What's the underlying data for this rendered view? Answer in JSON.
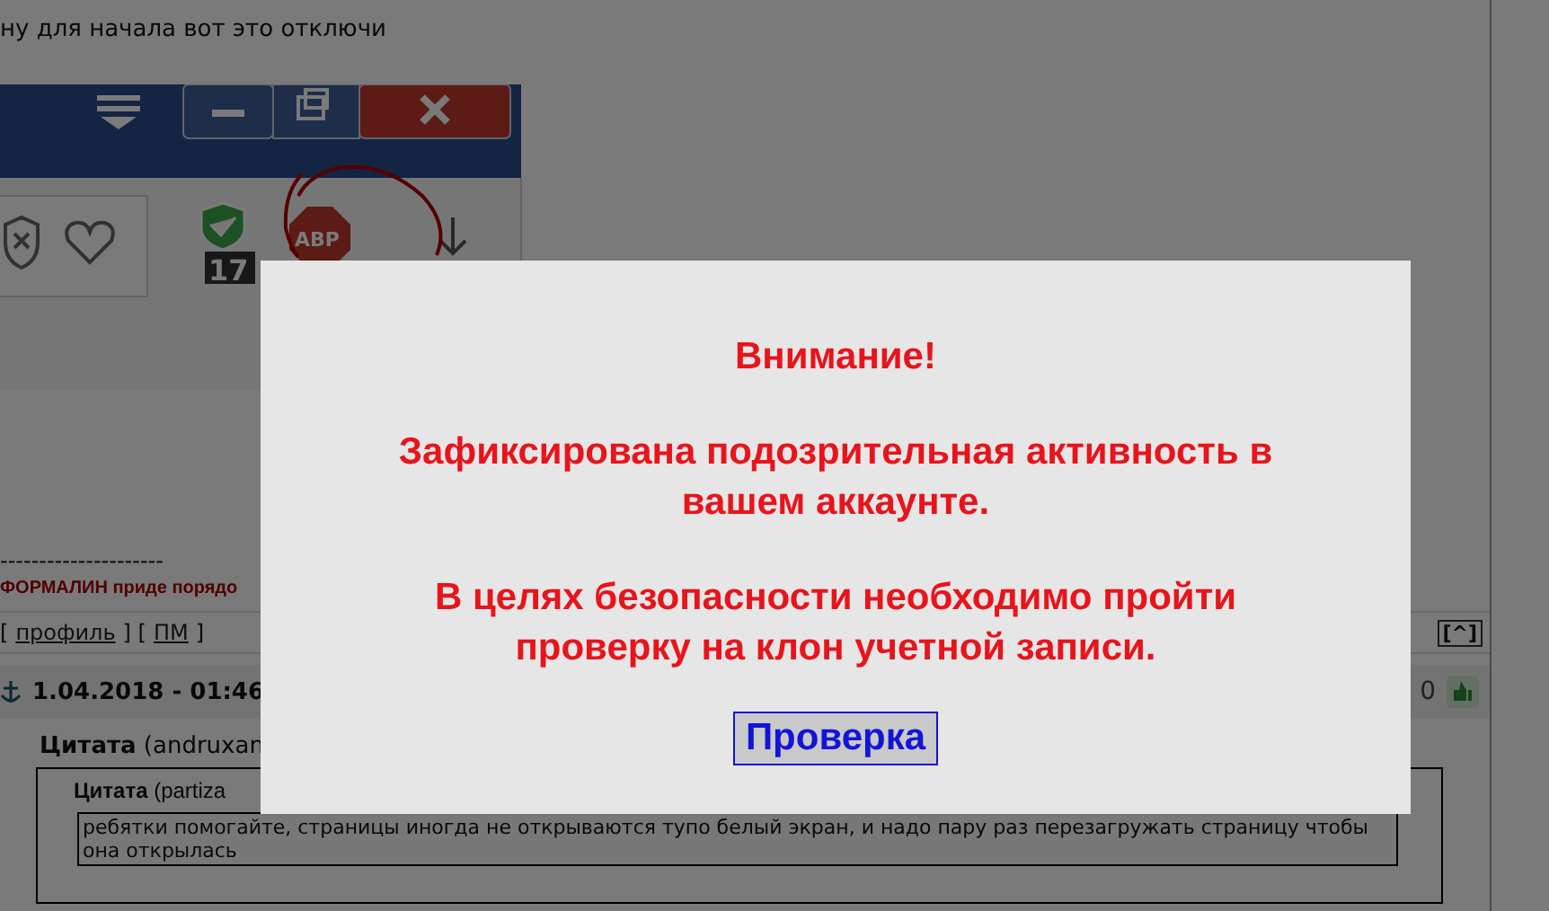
{
  "post": {
    "text": "ну для начала вот это отключи",
    "screenshot": {
      "badges": [
        {
          "kind": "check",
          "count": "17"
        },
        {
          "kind": "abp",
          "label": "ABP"
        }
      ],
      "circled": true
    },
    "signature_rule": "---------------------",
    "signature": "ФОРМАЛИН приде порядо"
  },
  "author_links": [
    {
      "kind": "plain",
      "text": "["
    },
    {
      "kind": "link",
      "text": "профиль"
    },
    {
      "kind": "plain",
      "text": "] ["
    },
    {
      "kind": "link",
      "text": "ПМ"
    },
    {
      "kind": "plain",
      "text": "]"
    }
  ],
  "top_link": "[^]",
  "next_post": {
    "date": "1.04.2018 - 01:46",
    "rating": "0",
    "quote": {
      "label": "Цитата",
      "meta": "(andruxan",
      "inner": {
        "label": "Цитата",
        "meta": "(partiza",
        "text": "ребятки помогайте, страницы иногда не открываются тупо белый экран, и надо пару раз перезагружать страницу чтобы она открылась"
      }
    }
  },
  "modal": {
    "title": "Внимание!",
    "paragraphs": [
      "Зафиксирована подозрительная активность в вашем аккаунте.",
      "В целях безопасности необходимо пройти проверку на клон учетной записи."
    ],
    "button": "Проверка"
  }
}
